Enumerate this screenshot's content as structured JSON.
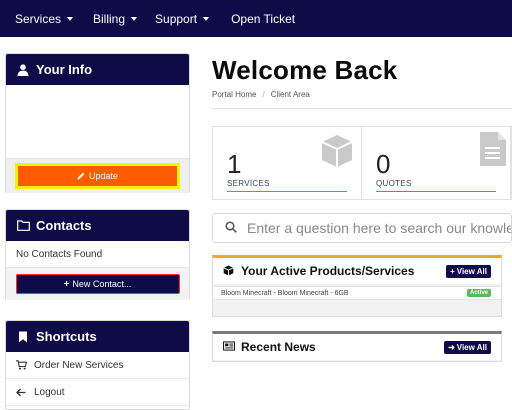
{
  "nav": {
    "items": [
      {
        "label": "Services",
        "has_caret": true
      },
      {
        "label": "Billing",
        "has_caret": true
      },
      {
        "label": "Support",
        "has_caret": true
      },
      {
        "label": "Open Ticket",
        "has_caret": false
      }
    ]
  },
  "sidebar": {
    "info": {
      "title": "Your Info",
      "icon": "user-icon",
      "update_label": "Update"
    },
    "contacts": {
      "title": "Contacts",
      "icon": "folder-icon",
      "empty_text": "No Contacts Found",
      "new_label": "New Contact..."
    },
    "shortcuts": {
      "title": "Shortcuts",
      "icon": "bookmark-icon",
      "items": [
        {
          "label": "Order New Services",
          "icon": "cart-icon"
        },
        {
          "label": "Logout",
          "icon": "arrow-left-icon"
        }
      ]
    }
  },
  "main": {
    "title": "Welcome Back",
    "breadcrumb": [
      "Portal Home",
      "Client Area"
    ],
    "stats": [
      {
        "value": "1",
        "label": "SERVICES",
        "icon": "cube-icon",
        "bar_color": "#23a6e8"
      },
      {
        "value": "0",
        "label": "QUOTES",
        "icon": "document-icon",
        "bar_color": "#3fae49"
      }
    ],
    "search_placeholder": "Enter a question here to search our knowledgebase for answers...",
    "products": {
      "title": "Your Active Products/Services",
      "view_all": "View All",
      "rows": [
        {
          "name": "Bloom Minecraft - Bloom Minecraft - 6GB",
          "status": "Active"
        }
      ]
    },
    "news": {
      "title": "Recent News",
      "view_all": "View All"
    }
  },
  "colors": {
    "nav_bg": "#0e0b48",
    "update_btn": "#ff5b00",
    "highlight": "#f6f500",
    "products_accent": "#f5a623",
    "active_badge": "#5cb85c"
  }
}
